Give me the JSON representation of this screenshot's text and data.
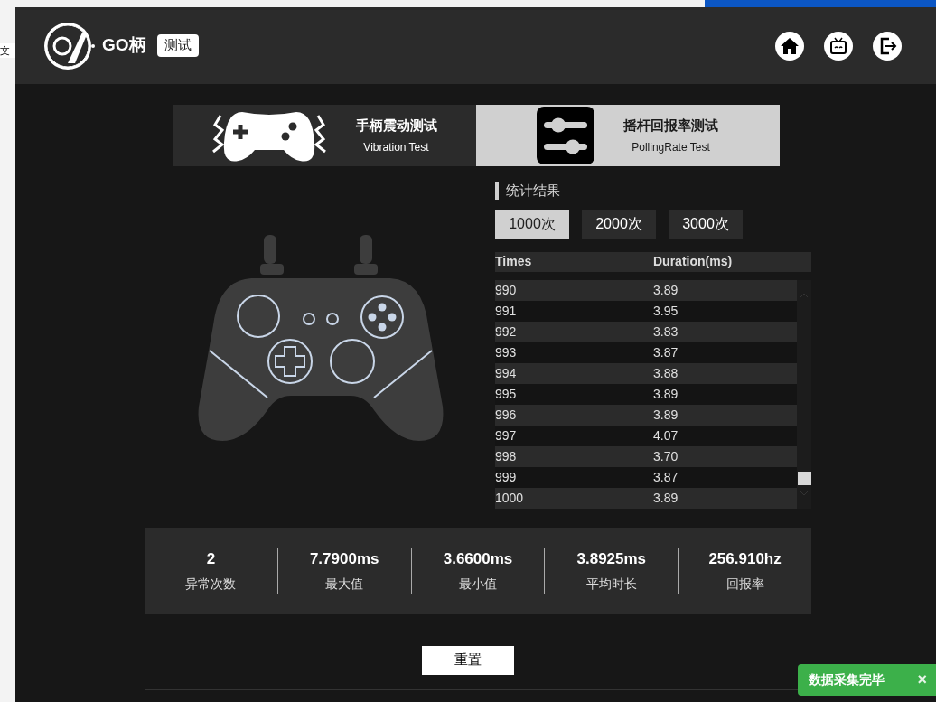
{
  "desktop": {
    "side_text": "文"
  },
  "header": {
    "brand": "GO柄",
    "badge": "测试"
  },
  "tabs": [
    {
      "title": "手柄震动测试",
      "subtitle": "Vibration Test",
      "kind": "vibration",
      "selected": false
    },
    {
      "title": "摇杆回报率测试",
      "subtitle": "PollingRate Test",
      "kind": "polling",
      "selected": true
    }
  ],
  "stats": {
    "title": "统计结果",
    "options": [
      {
        "label": "1000次",
        "selected": true
      },
      {
        "label": "2000次",
        "selected": false
      },
      {
        "label": "3000次",
        "selected": false
      }
    ]
  },
  "table": {
    "columns": [
      "Times",
      "Duration(ms)"
    ],
    "rows": [
      [
        "990",
        "3.89"
      ],
      [
        "991",
        "3.95"
      ],
      [
        "992",
        "3.83"
      ],
      [
        "993",
        "3.87"
      ],
      [
        "994",
        "3.88"
      ],
      [
        "995",
        "3.89"
      ],
      [
        "996",
        "3.89"
      ],
      [
        "997",
        "4.07"
      ],
      [
        "998",
        "3.70"
      ],
      [
        "999",
        "3.87"
      ],
      [
        "1000",
        "3.89"
      ]
    ]
  },
  "summary": [
    {
      "value": "2",
      "label": "异常次数"
    },
    {
      "value": "7.7900ms",
      "label": "最大值"
    },
    {
      "value": "3.6600ms",
      "label": "最小值"
    },
    {
      "value": "3.8925ms",
      "label": "平均时长"
    },
    {
      "value": "256.910hz",
      "label": "回报率"
    }
  ],
  "reset_button": "重置",
  "toast": {
    "text": "数据采集完毕",
    "close": "×"
  }
}
